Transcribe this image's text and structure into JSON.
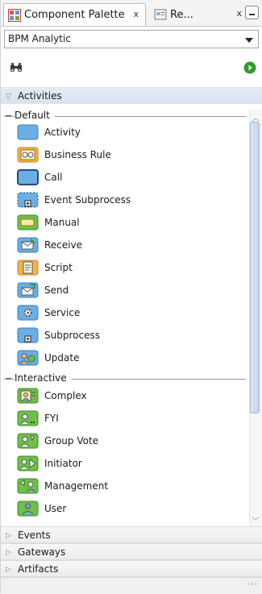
{
  "tabs": [
    {
      "label": "Component Palette",
      "close": "x",
      "icon": "palette-grid-icon"
    },
    {
      "label": "Re...",
      "close": "x",
      "icon": "resource-icon"
    }
  ],
  "palette_select": {
    "value": "BPM Analytic"
  },
  "search": {
    "placeholder": ""
  },
  "categories": {
    "activities": "Activities",
    "events": "Events",
    "gateways": "Gateways",
    "artifacts": "Artifacts"
  },
  "sections": {
    "default": "Default",
    "interactive": "Interactive"
  },
  "default_items": [
    {
      "label": "Activity",
      "icon": "activity-icon"
    },
    {
      "label": "Business Rule",
      "icon": "business-rule-icon"
    },
    {
      "label": "Call",
      "icon": "call-icon"
    },
    {
      "label": "Event Subprocess",
      "icon": "event-subprocess-icon"
    },
    {
      "label": "Manual",
      "icon": "manual-icon"
    },
    {
      "label": "Receive",
      "icon": "receive-icon"
    },
    {
      "label": "Script",
      "icon": "script-icon"
    },
    {
      "label": "Send",
      "icon": "send-icon"
    },
    {
      "label": "Service",
      "icon": "service-icon"
    },
    {
      "label": "Subprocess",
      "icon": "subprocess-icon"
    },
    {
      "label": "Update",
      "icon": "update-icon"
    }
  ],
  "interactive_items": [
    {
      "label": "Complex",
      "icon": "complex-icon"
    },
    {
      "label": "FYI",
      "icon": "fyi-icon"
    },
    {
      "label": "Group Vote",
      "icon": "group-vote-icon"
    },
    {
      "label": "Initiator",
      "icon": "initiator-icon"
    },
    {
      "label": "Management",
      "icon": "management-icon"
    },
    {
      "label": "User",
      "icon": "user-icon"
    }
  ],
  "colors": {
    "task_blue": "#6aaee4",
    "task_orange": "#f2b24c",
    "task_green": "#6fbf4a",
    "header_blue": "#d6e2ef",
    "add_green": "#2f9a2f"
  },
  "scrollbar": {
    "position": 0.0,
    "visible_fraction": 0.75
  },
  "resize_grip": "‹‹‹"
}
